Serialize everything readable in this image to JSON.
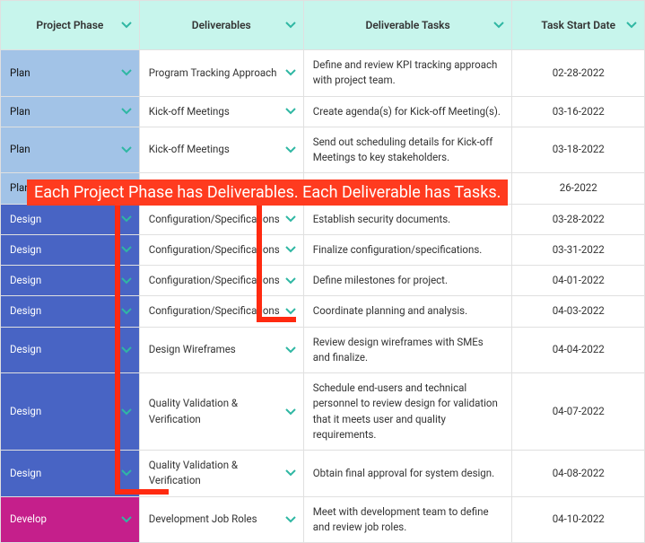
{
  "columns": {
    "phase": "Project Phase",
    "deliv": "Deliverables",
    "task": "Deliverable Tasks",
    "date": "Task Start Date"
  },
  "callout": "Each Project Phase has Deliverables. Each Deliverable has Tasks.",
  "chevColor": "#2fb7a3",
  "rows": [
    {
      "phase": "Plan",
      "phaseClass": "plan",
      "deliv": "Program Tracking Approach",
      "task": "Define and review KPI tracking approach with project team.",
      "date": "02-28-2022"
    },
    {
      "phase": "Plan",
      "phaseClass": "plan",
      "deliv": "Kick-off Meetings",
      "task": "Create agenda(s) for Kick-off Meeting(s).",
      "date": "03-16-2022"
    },
    {
      "phase": "Plan",
      "phaseClass": "plan",
      "deliv": "Kick-off Meetings",
      "task": "Send out scheduling details for Kick-off Meetings to key stakeholders.",
      "date": "03-18-2022"
    },
    {
      "phase": "Plan",
      "phaseClass": "plan",
      "deliv": "",
      "task": "",
      "date": "26-2022"
    },
    {
      "phase": "Design",
      "phaseClass": "design",
      "deliv": "Configuration/Specifications",
      "task": "Establish security documents.",
      "date": "03-28-2022"
    },
    {
      "phase": "Design",
      "phaseClass": "design",
      "deliv": "Configuration/Specifications",
      "task": "Finalize configuration/specifications.",
      "date": "03-31-2022"
    },
    {
      "phase": "Design",
      "phaseClass": "design",
      "deliv": "Configuration/Specifications",
      "task": "Define milestones for project.",
      "date": "04-01-2022"
    },
    {
      "phase": "Design",
      "phaseClass": "design",
      "deliv": "Configuration/Specifications",
      "task": "Coordinate planning and analysis.",
      "date": "04-03-2022"
    },
    {
      "phase": "Design",
      "phaseClass": "design",
      "deliv": "Design Wireframes",
      "task": "Review design wireframes with SMEs and finalize.",
      "date": "04-04-2022"
    },
    {
      "phase": "Design",
      "phaseClass": "design",
      "deliv": "Quality Validation & Verification",
      "task": "Schedule end-users and technical personnel to review design for validation that it meets user and quality requirements.",
      "date": "04-07-2022"
    },
    {
      "phase": "Design",
      "phaseClass": "design",
      "deliv": "Quality Validation & Verification",
      "task": "Obtain final approval for system design.",
      "date": "04-08-2022"
    },
    {
      "phase": "Develop",
      "phaseClass": "develop",
      "deliv": "Development Job Roles",
      "task": "Meet with development team to define and review job roles.",
      "date": "04-10-2022"
    }
  ]
}
